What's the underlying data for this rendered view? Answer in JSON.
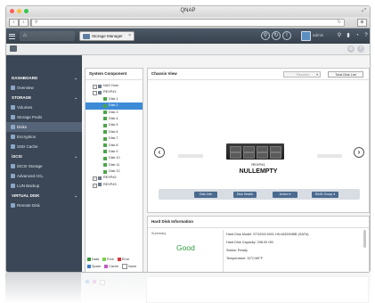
{
  "window": {
    "title": "QNAP"
  },
  "header": {
    "home_tab_label": "",
    "storage_tab_label": "Storage Manager",
    "username": "admin"
  },
  "sidebar": {
    "sections": [
      {
        "label": "DASHBOARD",
        "items": [
          {
            "label": "Overview"
          }
        ]
      },
      {
        "label": "STORAGE",
        "items": [
          {
            "label": "Volumes"
          },
          {
            "label": "Storage Pools"
          },
          {
            "label": "Disks"
          },
          {
            "label": "Encryption"
          },
          {
            "label": "SSD Cache"
          }
        ]
      },
      {
        "label": "iSCSI",
        "items": [
          {
            "label": "iSCSI Storage"
          },
          {
            "label": "Advanced ACL"
          },
          {
            "label": "LUN Backup"
          }
        ]
      },
      {
        "label": "VIRTUAL DISK",
        "items": [
          {
            "label": "Remote Disk"
          }
        ]
      }
    ],
    "active_item": "Disks"
  },
  "system_component": {
    "title": "System Component",
    "tree": [
      {
        "label": "NAS Host",
        "level": 0,
        "type": "nas",
        "expander": "+"
      },
      {
        "label": "REXP#1",
        "level": 0,
        "type": "nas",
        "expander": "-"
      },
      {
        "label": "Disk 1",
        "level": 1,
        "type": "disk"
      },
      {
        "label": "Disk 2",
        "level": 1,
        "type": "disk",
        "selected": true
      },
      {
        "label": "Disk 3",
        "level": 1,
        "type": "disk"
      },
      {
        "label": "Disk 4",
        "level": 1,
        "type": "disk"
      },
      {
        "label": "Disk 5",
        "level": 1,
        "type": "disk"
      },
      {
        "label": "Disk 6",
        "level": 1,
        "type": "disk"
      },
      {
        "label": "Disk 7",
        "level": 1,
        "type": "disk"
      },
      {
        "label": "Disk 8",
        "level": 1,
        "type": "disk"
      },
      {
        "label": "Disk 9",
        "level": 1,
        "type": "disk"
      },
      {
        "label": "Disk 10",
        "level": 1,
        "type": "disk"
      },
      {
        "label": "Disk 11",
        "level": 1,
        "type": "disk"
      },
      {
        "label": "Disk 12",
        "level": 1,
        "type": "disk"
      },
      {
        "label": "REXP#2",
        "level": 0,
        "type": "nas",
        "expander": "+"
      },
      {
        "label": "REXP#3",
        "level": 0,
        "type": "nas",
        "expander": "+"
      }
    ],
    "legend": [
      {
        "label": "Data",
        "color": "#3a9a3c"
      },
      {
        "label": "Free",
        "color": "#7ccf4e"
      },
      {
        "label": "Error",
        "color": "#d9363e"
      },
      {
        "label": "Spare",
        "color": "#3d7fd1"
      },
      {
        "label": "Cache",
        "color": "#c05ac2"
      },
      {
        "label": "None",
        "color": "#ffffff"
      }
    ]
  },
  "chassis_view": {
    "title": "Chassis View",
    "select_placeholder": "Recover",
    "total_disk_list_label": "Total Disk List",
    "enclosure_label": "REXP#1",
    "device_name": "NULLEMPTY",
    "actions": [
      "Disk Info",
      "Disk Health",
      "Action ▾",
      "RAID Group ▾"
    ]
  },
  "hard_disk_info": {
    "title": "Hard Disk Information",
    "summary_label": "Summary",
    "status_big": "Good",
    "details": [
      "Hard Disk Model: ST3200L9001 HN-M320MBB (SATA)",
      "Hard Disk Capacity: 298.09 GB",
      "Status: Ready",
      "Temperature: 32°C/89°F"
    ]
  },
  "colors": {
    "sidebar_bg": "#3b4756",
    "header_bg": "#37414c",
    "selected": "#3d8bd6",
    "good": "#2e9d3c"
  }
}
